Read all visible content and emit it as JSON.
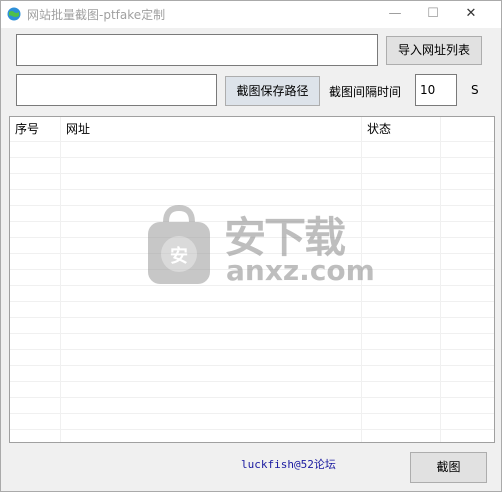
{
  "window": {
    "title": "网站批量截图-ptfake定制",
    "minimize": "—",
    "maximize": "☐",
    "close": "✕"
  },
  "import_row": {
    "url_list_value": "",
    "import_button_label": "导入网址列表"
  },
  "path_row": {
    "save_path_value": "",
    "save_path_button_label": "截图保存路径",
    "interval_label": "截图间隔时间",
    "interval_value": "10",
    "unit_label": "S"
  },
  "list": {
    "columns": [
      "序号",
      "网址",
      "状态"
    ],
    "rows": []
  },
  "watermark": {
    "text_cn": "安下载",
    "text_en": "anxz.com",
    "icon_text": "安"
  },
  "footer": {
    "credit": "luckfish@52论坛",
    "screenshot_button_label": "截图"
  }
}
